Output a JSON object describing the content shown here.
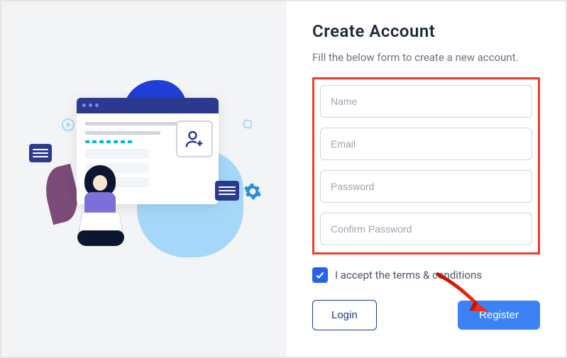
{
  "page": {
    "title": "Create Account",
    "subtitle": "Fill the below form to create a new account."
  },
  "form": {
    "name_placeholder": "Name",
    "email_placeholder": "Email",
    "password_placeholder": "Password",
    "confirm_password_placeholder": "Confirm Password"
  },
  "terms": {
    "checked": true,
    "label": "I accept the terms & conditions"
  },
  "buttons": {
    "login_label": "Login",
    "register_label": "Register"
  },
  "annotation": {
    "highlight_color": "#ef3c2d",
    "arrow_color": "#ef1c0d"
  },
  "colors": {
    "primary": "#2563eb",
    "button_primary": "#3b82f6",
    "link": "#1e3a8a"
  }
}
